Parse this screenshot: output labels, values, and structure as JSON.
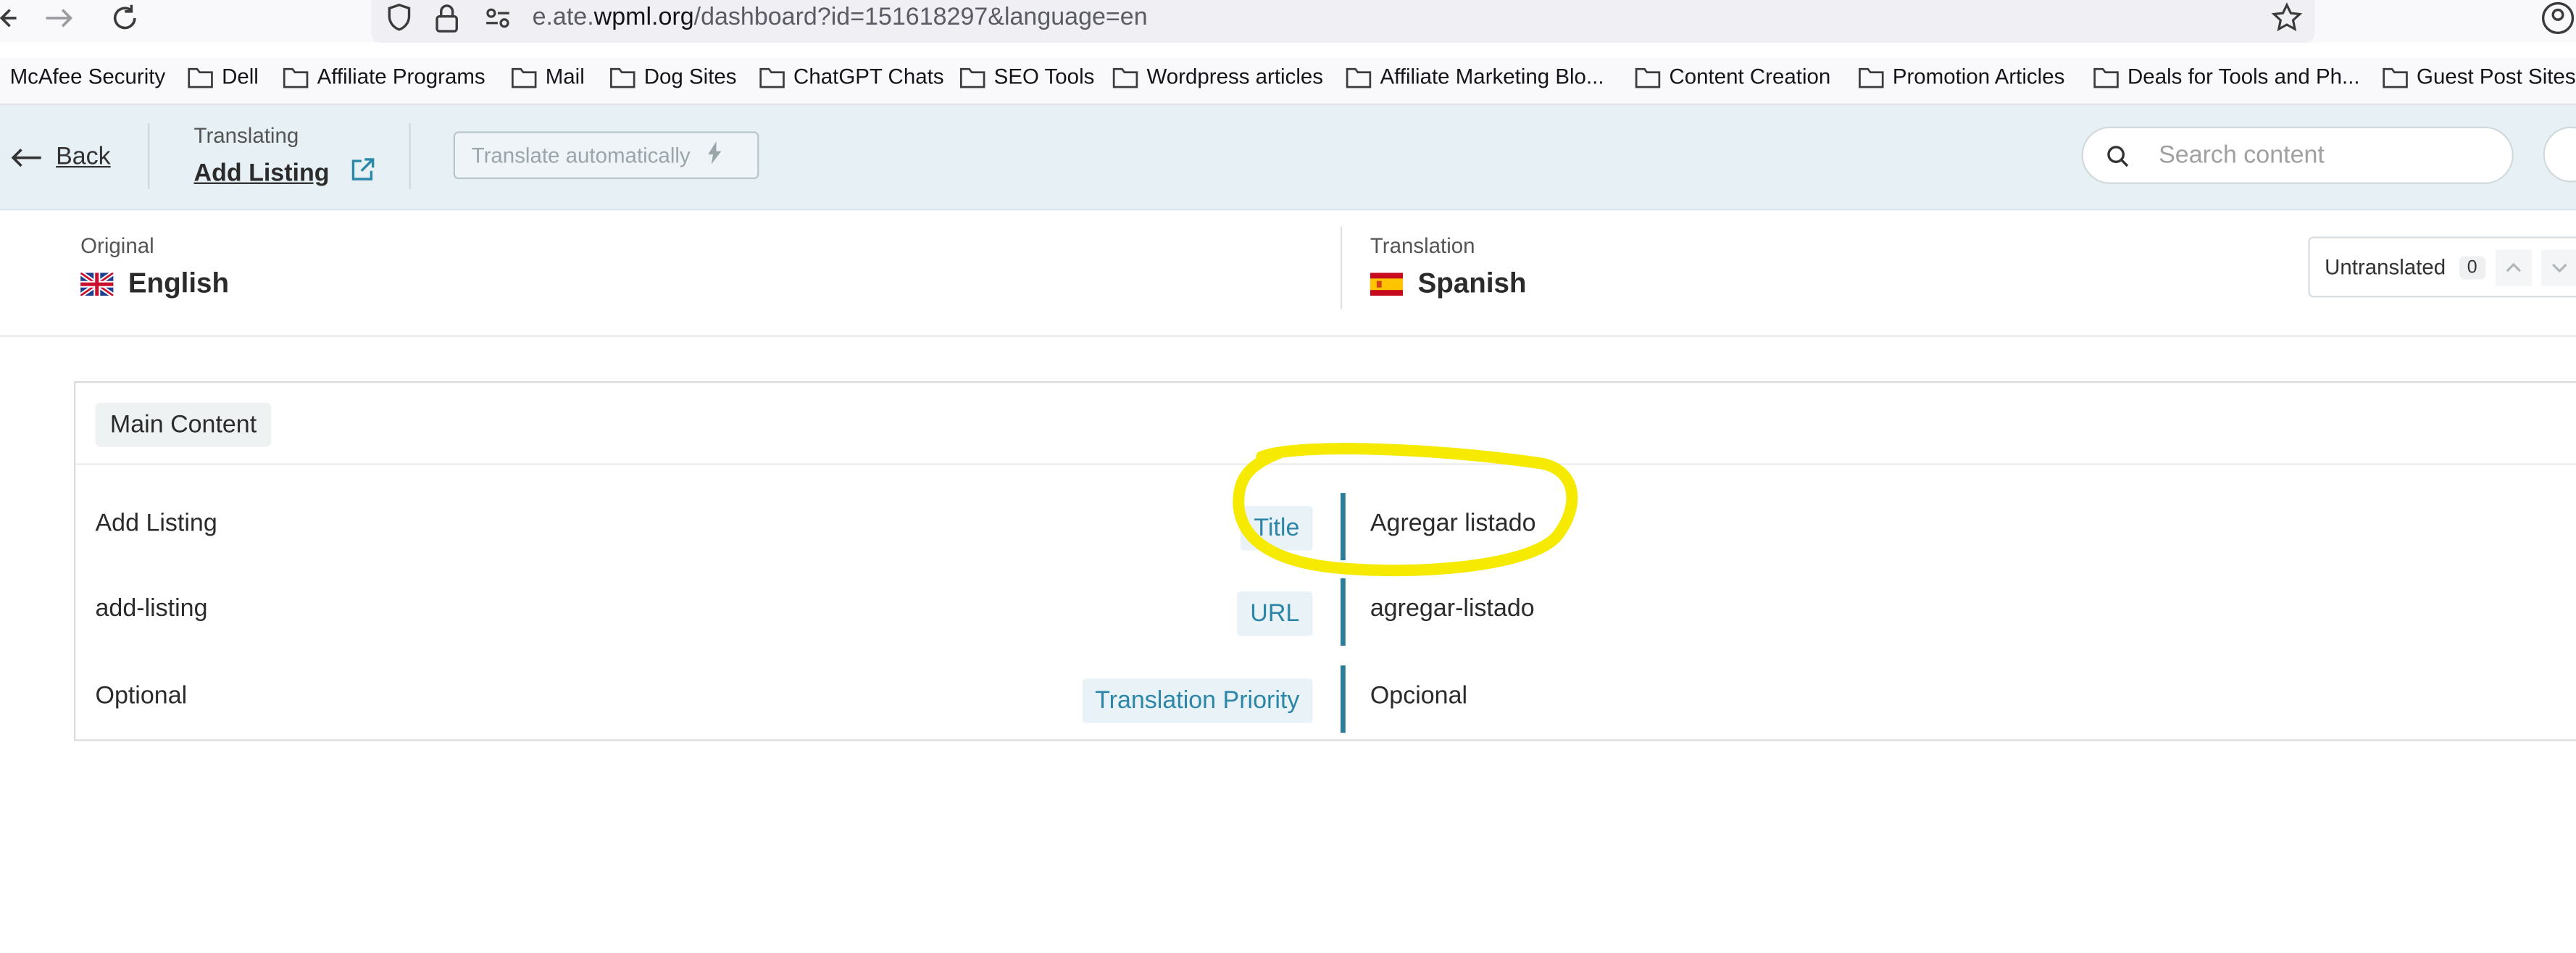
{
  "browser": {
    "url_prefix": "e.ate.",
    "url_domain": "wpml.org",
    "url_path": "/dashboard?id=151618297&language=en",
    "bookmarks": [
      "McAfee Security",
      "Dell",
      "Affiliate Programs",
      "Mail",
      "Dog Sites",
      "ChatGPT Chats",
      "SEO Tools",
      "Wordpress articles",
      "Affiliate Marketing Blo...",
      "Content Creation",
      "Promotion Articles",
      "Deals for Tools and Ph...",
      "Guest Post Sites"
    ]
  },
  "header": {
    "back_label": "Back",
    "translating_label": "Translating",
    "document_title": "Add Listing",
    "translate_button": "Translate automatically",
    "search_placeholder": "Search content"
  },
  "languages": {
    "original_label": "Original",
    "original_name": "English",
    "translation_label": "Translation",
    "translation_name": "Spanish",
    "filter_label": "Untranslated",
    "filter_count": "0"
  },
  "content": {
    "section": "Main Content",
    "rows": [
      {
        "original": "Add Listing",
        "tag": "Title",
        "translation": "Agregar listado"
      },
      {
        "original": "add-listing",
        "tag": "URL",
        "translation": "agregar-listado"
      },
      {
        "original": "Optional",
        "tag": "Translation Priority",
        "translation": "Opcional"
      }
    ]
  },
  "colors": {
    "accent": "#2a7d98",
    "header_bg": "#e7f1f5",
    "annotation": "#f5ea00"
  }
}
